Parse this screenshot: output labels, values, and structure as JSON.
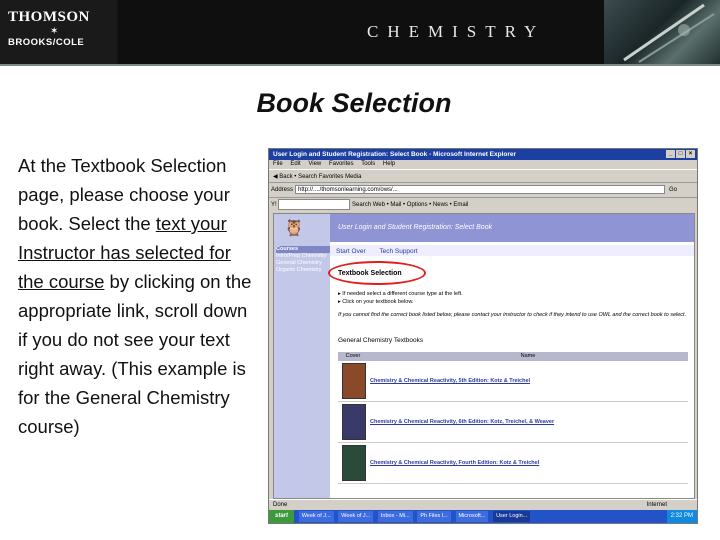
{
  "header": {
    "logo_line1": "THOMSON",
    "logo_line2": "BROOKS/COLE",
    "banner_title": "CHEMISTRY"
  },
  "slide": {
    "title": "Book Selection",
    "body_part1": "At the Textbook Selection page, please choose your book.  Select the ",
    "body_link1": "text your Instructor has selected for the course",
    "body_part2": " by clicking on the appropriate link, scroll down if you do not see your text right away. (This example is for the General Chemistry course)"
  },
  "browser": {
    "window_title": "User Login and Student Registration: Select Book - Microsoft Internet Explorer",
    "menu": [
      "File",
      "Edit",
      "View",
      "Favorites",
      "Tools",
      "Help"
    ],
    "toolbar_text": "Back  •  Search  Favorites  Media",
    "address_label": "Address",
    "address_url": "http://..../thomsonlearning.com/ows/...",
    "go_label": "Go",
    "links_text": "Search Web  •  Mail  •  Options  •  News  •  Email",
    "status_left": "Done",
    "status_zone": "Internet"
  },
  "page": {
    "header_title": "User Login and Student Registration: Select Book",
    "courses_heading": "Courses",
    "courses": [
      "Intro/Prep Chemistry",
      "General Chemistry",
      "Organic Chemistry"
    ],
    "tabs": [
      "Start Over",
      "Tech Support"
    ],
    "section_title": "Textbook Selection",
    "bullets": [
      "If needed select a different course type at the left.",
      "Click on your textbook below."
    ],
    "note": "If you cannot find the correct book listed below, please contact your instructor to check if they intend to use OWL and the correct book to select.",
    "list_title": "General Chemistry Textbooks",
    "table_headers": [
      "Cover",
      "Name"
    ],
    "books": [
      {
        "title": "Chemistry & Chemical Reactivity, 5th Edition: Kotz & Treichel",
        "color": "#8a4a2a"
      },
      {
        "title": "Chemistry & Chemical Reactivity, 6th Edition: Kotz, Treichel, & Weaver",
        "color": "#3a3a6a"
      },
      {
        "title": "Chemistry & Chemical Reactivity, Fourth Edition: Kotz & Treichel",
        "color": "#2a4a3a"
      }
    ]
  },
  "taskbar": {
    "start": "start",
    "tasks": [
      "Week of J...",
      "Week of J...",
      "Inbox - Mi...",
      "Ph Files I...",
      "Microsoft...",
      "User Login..."
    ],
    "clock": "2:32 PM"
  }
}
